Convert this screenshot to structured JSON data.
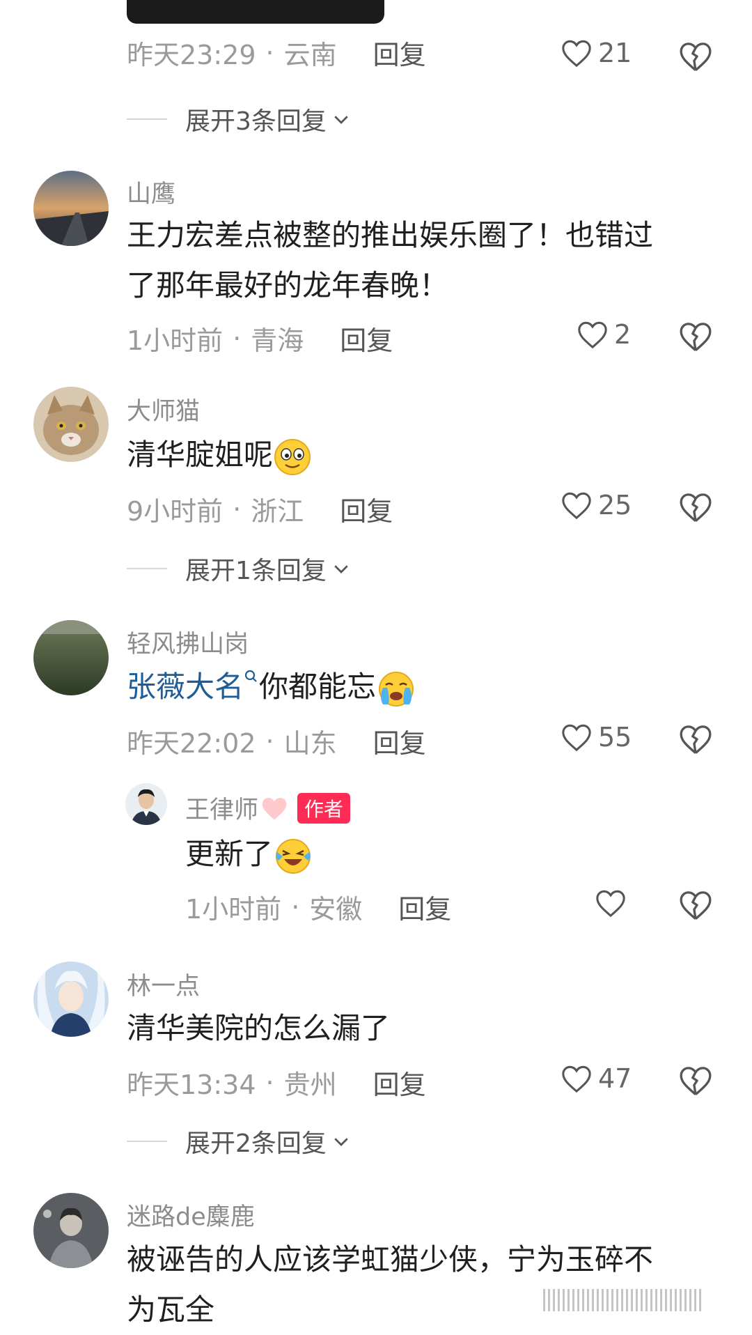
{
  "comments": [
    {
      "time": "昨天23:29",
      "location": "云南",
      "reply_label": "回复",
      "likes": "21",
      "expand_label": "展开3条回复"
    },
    {
      "name": "山鹰",
      "text_line1": "王力宏差点被整的推出娱乐圈了！也错过",
      "text_line2": "了那年最好的龙年春晚！",
      "time": "1小时前",
      "location": "青海",
      "reply_label": "回复",
      "likes": "2"
    },
    {
      "name": "大师猫",
      "text": "清华腚姐呢",
      "time": "9小时前",
      "location": "浙江",
      "reply_label": "回复",
      "likes": "25",
      "expand_label": "展开1条回复"
    },
    {
      "name": "轻风拂山岗",
      "link_text": "张薇大名",
      "text": "你都能忘",
      "time": "昨天22:02",
      "location": "山东",
      "reply_label": "回复",
      "likes": "55",
      "reply": {
        "name": "王律师",
        "badge": "作者",
        "text": "更新了",
        "time": "1小时前",
        "location": "安徽",
        "reply_label": "回复"
      }
    },
    {
      "name": "林一点",
      "text": "清华美院的怎么漏了",
      "time": "昨天13:34",
      "location": "贵州",
      "reply_label": "回复",
      "likes": "47",
      "expand_label": "展开2条回复"
    },
    {
      "name": "迷路de麋鹿",
      "text_line1": "被诬告的人应该学虹猫少侠，宁为玉碎不",
      "text_line2": "为瓦全"
    }
  ],
  "separator": "·",
  "icons": {
    "like": "heart-outline-icon",
    "dislike": "broken-heart-icon",
    "chevron": "chevron-down-icon",
    "search": "search-icon"
  },
  "colors": {
    "accent": "#fe2c55",
    "link": "#1f5d97",
    "muted": "#9a9a9a"
  }
}
